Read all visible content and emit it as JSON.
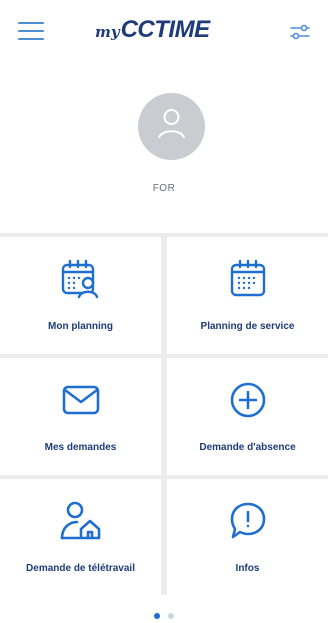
{
  "header": {
    "logo_prefix": "my",
    "logo_brand": "CCTIME",
    "menu_icon": "hamburger-menu-icon",
    "filter_icon": "sliders-icon"
  },
  "user": {
    "name": "FOR",
    "avatar_icon": "person-icon"
  },
  "tiles": [
    {
      "label": "Mon planning",
      "icon": "calendar-person-icon"
    },
    {
      "label": "Planning de service",
      "icon": "calendar-icon"
    },
    {
      "label": "Mes demandes",
      "icon": "envelope-icon"
    },
    {
      "label": "Demande d'absence",
      "icon": "plus-circle-icon"
    },
    {
      "label": "Demande de télétravail",
      "icon": "person-home-icon"
    },
    {
      "label": "Infos",
      "icon": "speech-bubble-exclamation-icon"
    }
  ],
  "pagination": {
    "current_page": 1,
    "total_pages": 2
  },
  "colors": {
    "primary": "#1f6fd1",
    "brand": "#1f3b7a",
    "accent": "#4d8fd6",
    "grid_bg": "#ececef",
    "avatar_bg": "#c9cdd2"
  }
}
